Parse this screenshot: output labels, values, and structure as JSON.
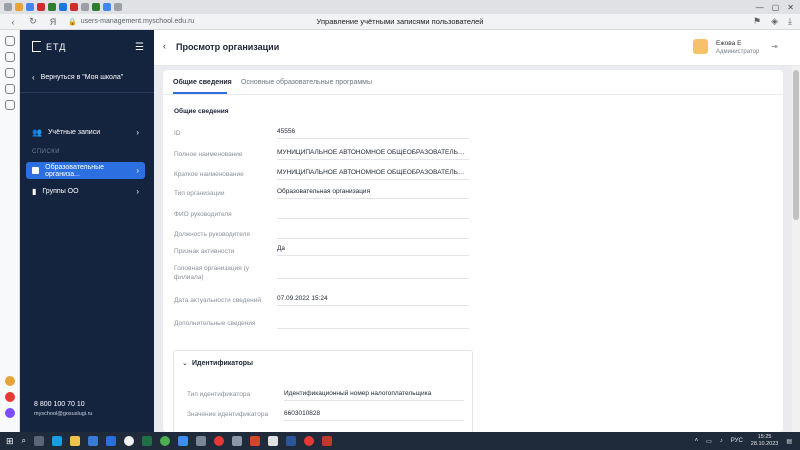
{
  "browser": {
    "url": "users-management.myschool.edu.ru",
    "page_title": "Управление учётными записями пользователей"
  },
  "sidebar": {
    "logo": "ЕТД",
    "back_label": "Вернуться в \"Моя школа\"",
    "items": [
      {
        "label": "Учётные записи"
      },
      {
        "label": "Образовательные организа..."
      },
      {
        "label": "Группы ОО"
      }
    ],
    "section_caption": "СПИСКИ",
    "phone": "8 800 100 70 10",
    "email": "myschool@gosuslugi.ru"
  },
  "header": {
    "title": "Просмотр организации",
    "user_name": "Ежова Е",
    "user_role": "Администратор"
  },
  "tabs": [
    {
      "label": "Общие сведения"
    },
    {
      "label": "Основные образовательные программы"
    }
  ],
  "general": {
    "section_title": "Общие сведения",
    "fields": [
      {
        "label": "ID",
        "value": "45556"
      },
      {
        "label": "Полное наименование",
        "value": "МУНИЦИПАЛЬНОЕ АВТОНОМНОЕ ОБЩЕОБРАЗОВАТЕЛЬНОЕ У..."
      },
      {
        "label": "Краткое наименование",
        "value": "МУНИЦИПАЛЬНОЕ АВТОНОМНОЕ ОБЩЕОБРАЗОВАТЕЛЬНОЕ У..."
      },
      {
        "label": "Тип организации",
        "value": "Образовательная организация"
      },
      {
        "label": "ФИО руководителя",
        "value": ""
      },
      {
        "label": "Должность руководителя",
        "value": ""
      },
      {
        "label": "Признак активности",
        "value": "Да"
      },
      {
        "label": "Головная организация (у филиала)",
        "value": ""
      },
      {
        "label": "Дата актуальности сведений",
        "value": "07.09.2022 15:24"
      },
      {
        "label": "Дополнительные сведения",
        "value": ""
      }
    ]
  },
  "identifiers": {
    "title": "Идентификаторы",
    "type_label": "Тип идентификатора",
    "type_value": "Идентификационный номер налогоплательщика",
    "value_label": "Значение идентификатора",
    "value_value": "6603010828"
  },
  "taskbar": {
    "lang": "РУС",
    "time": "15:25",
    "date": "28.10.2023"
  }
}
